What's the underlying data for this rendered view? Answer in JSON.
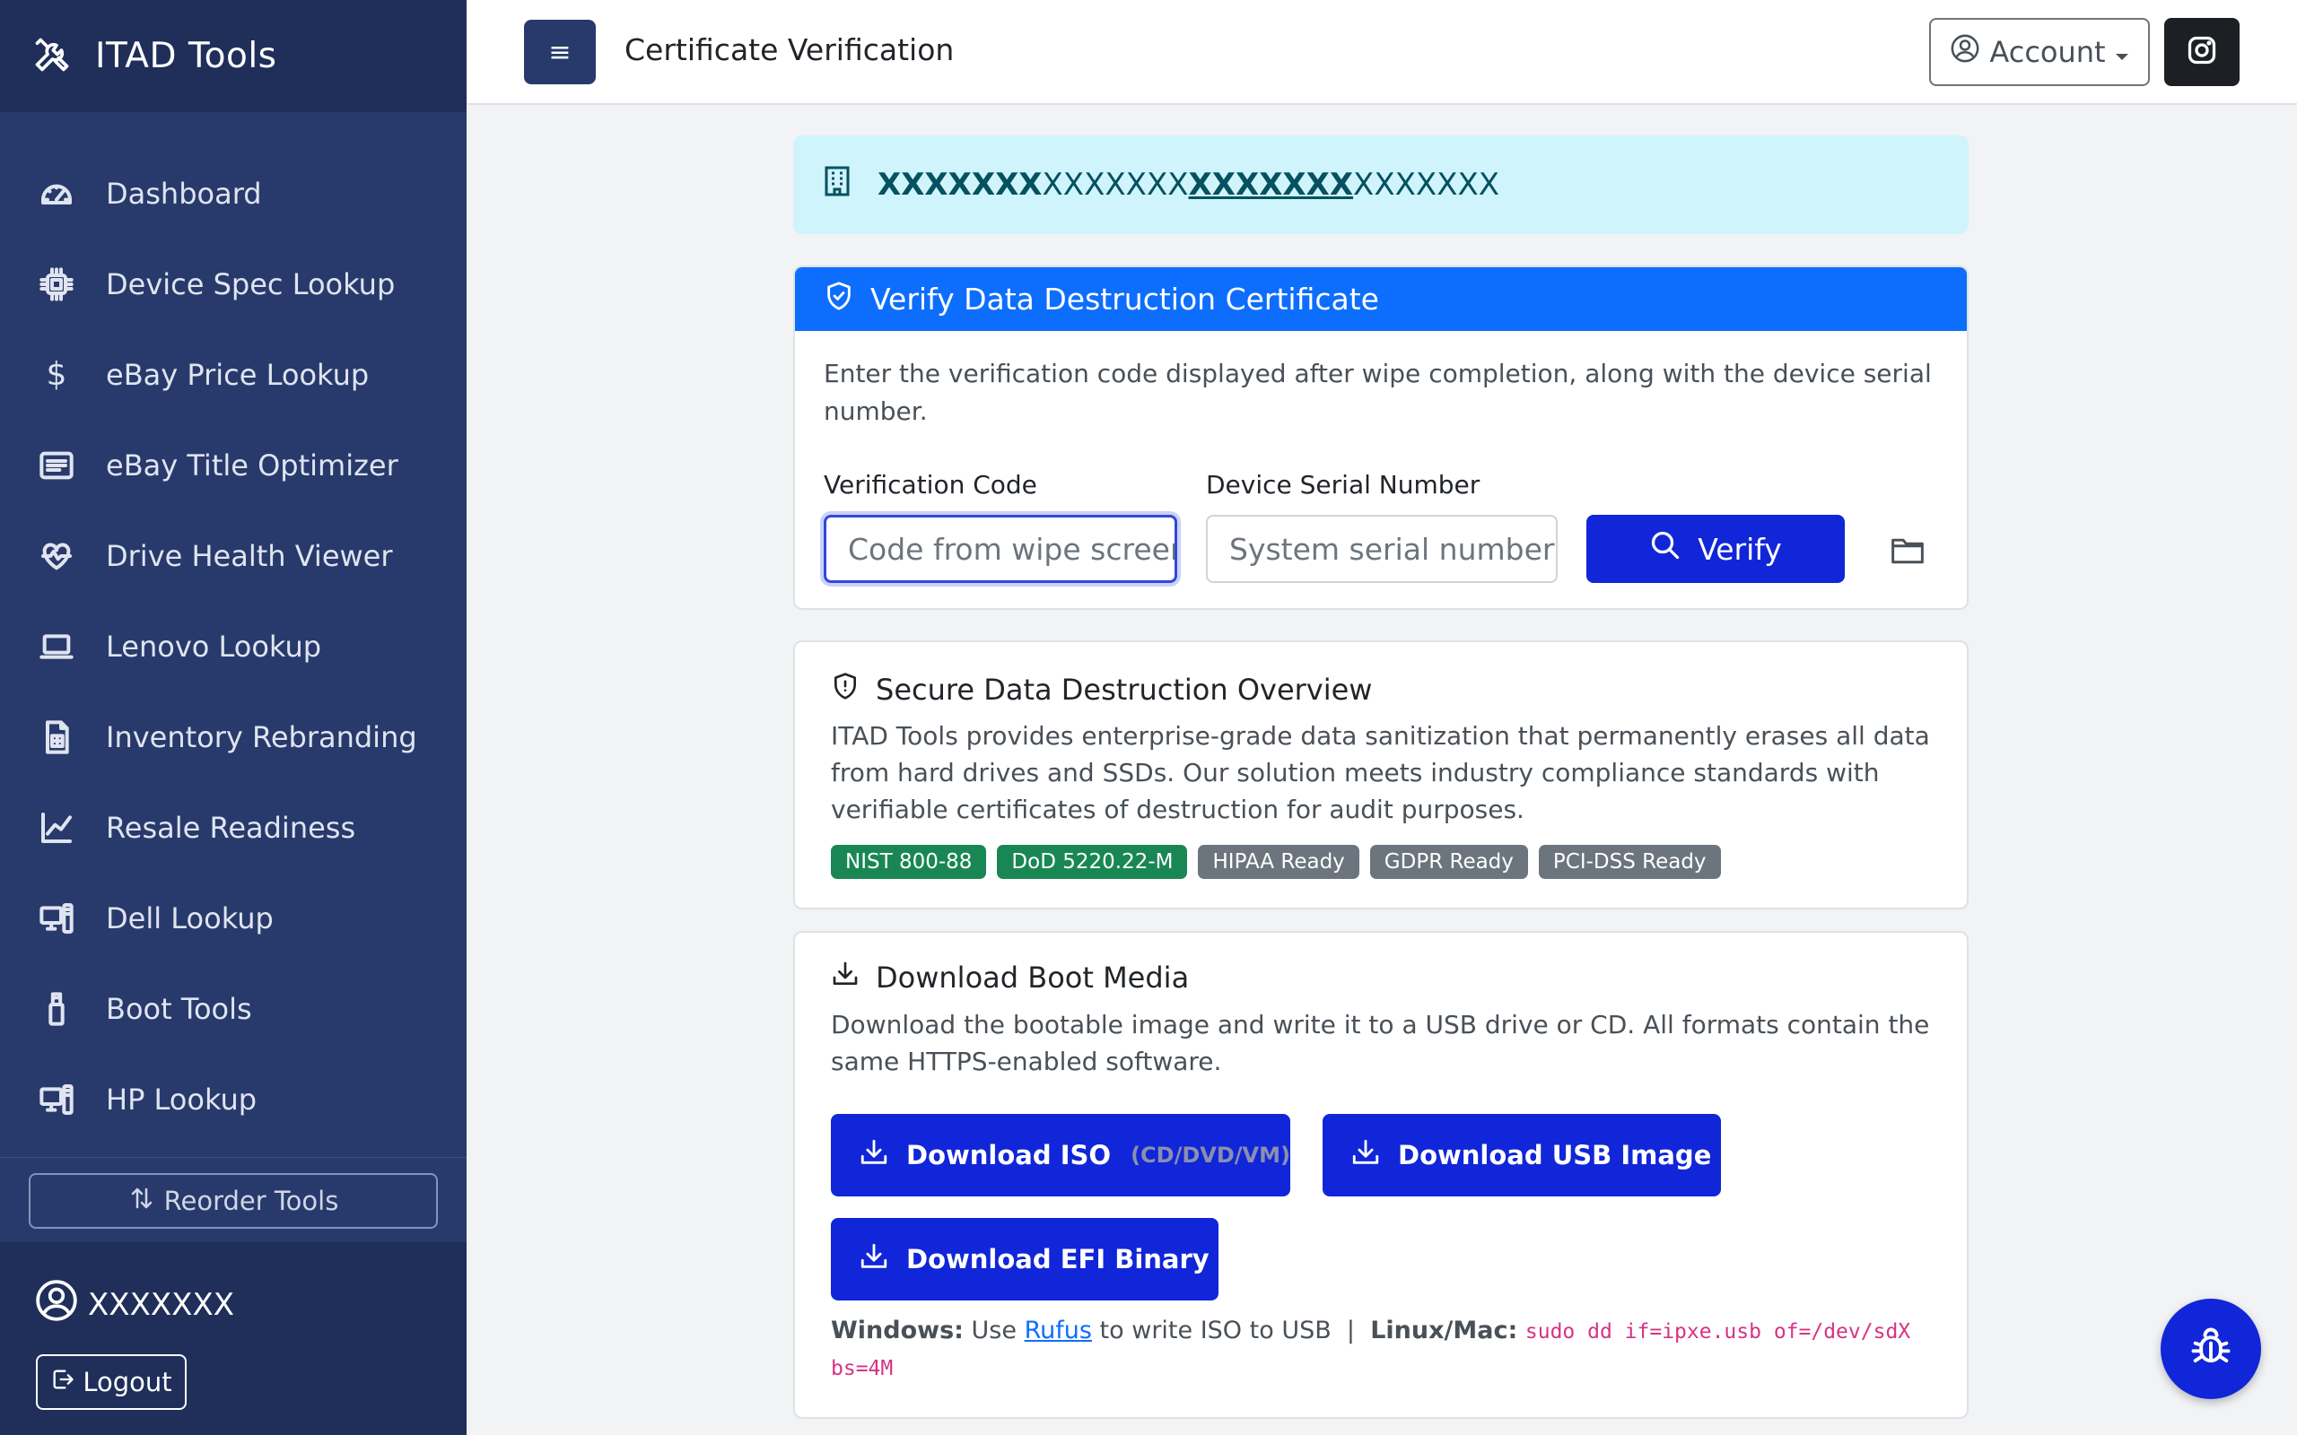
{
  "brand": {
    "title": "ITAD Tools",
    "icon": "tools-icon"
  },
  "sidebar": {
    "items": [
      {
        "label": "Dashboard",
        "icon": "speedometer-icon"
      },
      {
        "label": "Device Spec Lookup",
        "icon": "cpu-icon"
      },
      {
        "label": "eBay Price Lookup",
        "icon": "dollar-icon"
      },
      {
        "label": "eBay Title Optimizer",
        "icon": "card-text-icon"
      },
      {
        "label": "Drive Health Viewer",
        "icon": "heart-pulse-icon"
      },
      {
        "label": "Lenovo Lookup",
        "icon": "laptop-icon"
      },
      {
        "label": "Inventory Rebranding",
        "icon": "receipt-icon"
      },
      {
        "label": "Resale Readiness",
        "icon": "graph-up-icon"
      },
      {
        "label": "Dell Lookup",
        "icon": "pc-display-icon"
      },
      {
        "label": "Boot Tools",
        "icon": "usb-drive-icon"
      },
      {
        "label": "HP Lookup",
        "icon": "pc-display-icon"
      }
    ],
    "reorder_label": "Reorder Tools",
    "user_name": "XXXXXXX",
    "logout_label": "Logout"
  },
  "topbar": {
    "menu_glyph": "≡",
    "title": "Certificate Verification",
    "account_label": "Account"
  },
  "alert": {
    "part1": "XXXXXXX",
    "part2": "XXXXXXX",
    "part3": "XXXXXXX",
    "part4": "XXXXXXX"
  },
  "verify": {
    "header": "Verify Data Destruction Certificate",
    "description": "Enter the verification code displayed after wipe completion, along with the device serial number.",
    "code_label": "Verification Code",
    "code_placeholder": "Code from wipe screen",
    "serial_label": "Device Serial Number",
    "serial_placeholder": "System serial number",
    "button_label": "Verify"
  },
  "overview": {
    "title": "Secure Data Destruction Overview",
    "text": "ITAD Tools provides enterprise-grade data sanitization that permanently erases all data from hard drives and SSDs. Our solution meets industry compliance standards with verifiable certificates of destruction for audit purposes.",
    "badges": [
      {
        "label": "NIST 800-88",
        "color": "#198754"
      },
      {
        "label": "DoD 5220.22-M",
        "color": "#198754"
      },
      {
        "label": "HIPAA Ready",
        "color": "#6c757d"
      },
      {
        "label": "GDPR Ready",
        "color": "#6c757d"
      },
      {
        "label": "PCI-DSS Ready",
        "color": "#6c757d"
      }
    ]
  },
  "download": {
    "title": "Download Boot Media",
    "text": "Download the bootable image and write it to a USB drive or CD. All formats contain the same HTTPS-enabled software.",
    "iso_label": "Download ISO",
    "iso_note": "(CD/DVD/VM)",
    "usb_label": "Download USB Image",
    "efi_label": "Download EFI Binary",
    "windows_label": "Windows:",
    "windows_use": "Use",
    "rufus_link": "Rufus",
    "windows_rest": "to write ISO to USB",
    "separator": "|",
    "linux_label": "Linux/Mac:",
    "linux_cmd": "sudo dd if=ipxe.usb of=/dev/sdX bs=4M"
  },
  "colors": {
    "sidebar": "#283a6b",
    "sidebar_dark": "#1f2f5a",
    "primary": "#0d6efd",
    "button": "#1126d8",
    "alert_bg": "#cff4fc"
  }
}
